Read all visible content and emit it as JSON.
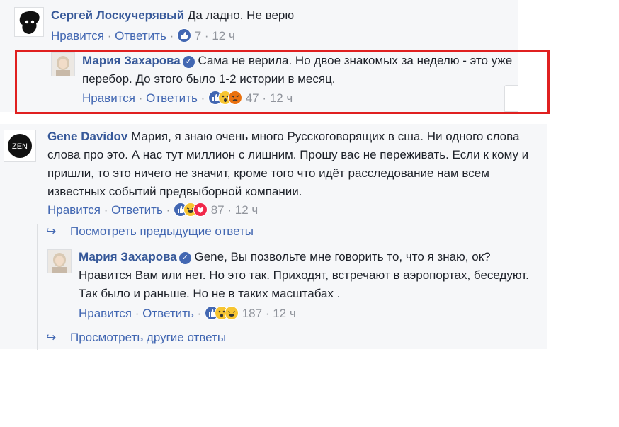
{
  "comments": [
    {
      "author": "Сергей Лоскучерявый",
      "text": "Да ладно. Не верю",
      "like": "Нравится",
      "reply": "Ответить",
      "count": "7",
      "time": "12 ч"
    },
    {
      "author": "Мария Захарова",
      "text": "Сама не верила. Но двое знакомых за неделю - это уже перебор. До этого было 1-2 истории в месяц.",
      "like": "Нравится",
      "reply": "Ответить",
      "count": "47",
      "time": "12 ч"
    },
    {
      "author": "Gene Davidov",
      "avatar_text": "ZEN",
      "text": "Мария, я знаю очень много Русскоговорящих в сша. Ни одного слова слова про это. А нас тут миллион с лишним. Прошу вас не переживать. Если к кому и пришли, то это ничего не значит, кроме того что идёт расследование нам всем известных событий предвыборной компании.",
      "like": "Нравится",
      "reply": "Ответить",
      "count": "87",
      "time": "12 ч"
    },
    {
      "author": "Мария Захарова",
      "text": "Gene, Вы позвольте мне говорить то, что я знаю, ок? Нравится Вам или нет. Но это так. Приходят, встречают в аэропортах, беседуют. Так было и раньше. Но не в таких масштабах .",
      "like": "Нравится",
      "reply": "Ответить",
      "count": "187",
      "time": "12 ч"
    }
  ],
  "view_previous_replies": "Посмотреть предыдущие ответы",
  "view_other_replies": "Просмотреть другие ответы",
  "separator": "·",
  "colors": {
    "highlight_box": "#e02020",
    "name": "#365899",
    "link": "#4267b2",
    "meta": "#90949c",
    "panel_bg": "#f6f7f9"
  },
  "icons": [
    "like-icon",
    "love-icon",
    "wow-icon",
    "haha-icon",
    "angry-icon",
    "verified-icon",
    "reply-arrow-icon"
  ]
}
